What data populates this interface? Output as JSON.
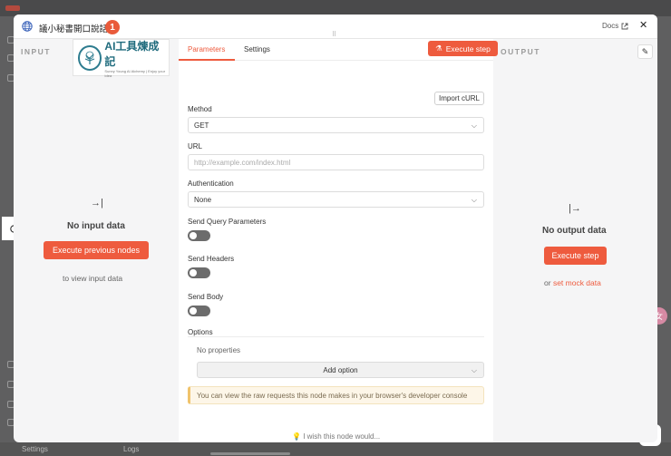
{
  "modal": {
    "title": "議小秘書開口說話",
    "badge": "1",
    "docs_label": "Docs"
  },
  "input_panel": {
    "label": "INPUT",
    "logo_text": "AI工具煉成記",
    "logo_subtext": "Sunny Young AI Alchemy | Enjoy your Idea",
    "empty_title": "No input data",
    "execute_previous": "Execute previous nodes",
    "hint": "to view input data"
  },
  "params": {
    "tabs": [
      {
        "label": "Parameters",
        "active": true
      },
      {
        "label": "Settings",
        "active": false
      }
    ],
    "execute_step": "Execute step",
    "import_curl": "Import cURL",
    "method_label": "Method",
    "method_value": "GET",
    "url_label": "URL",
    "url_placeholder": "http://example.com/index.html",
    "auth_label": "Authentication",
    "auth_value": "None",
    "send_query_label": "Send Query Parameters",
    "send_headers_label": "Send Headers",
    "send_body_label": "Send Body",
    "options_label": "Options",
    "no_properties": "No properties",
    "add_option": "Add option",
    "notice": "You can view the raw requests this node makes in your browser's developer console",
    "wish": "I wish this node would..."
  },
  "output_panel": {
    "label": "OUTPUT",
    "empty_title": "No output data",
    "execute_step": "Execute step",
    "or_text": "or",
    "mock_link": "set mock data"
  },
  "background": {
    "settings_label": "Settings",
    "logs_label": "Logs",
    "avatar_letter": "女"
  },
  "colors": {
    "accent": "#ee5b3e",
    "badge": "#e95b3b",
    "notice_bg": "#fdf6e8"
  }
}
